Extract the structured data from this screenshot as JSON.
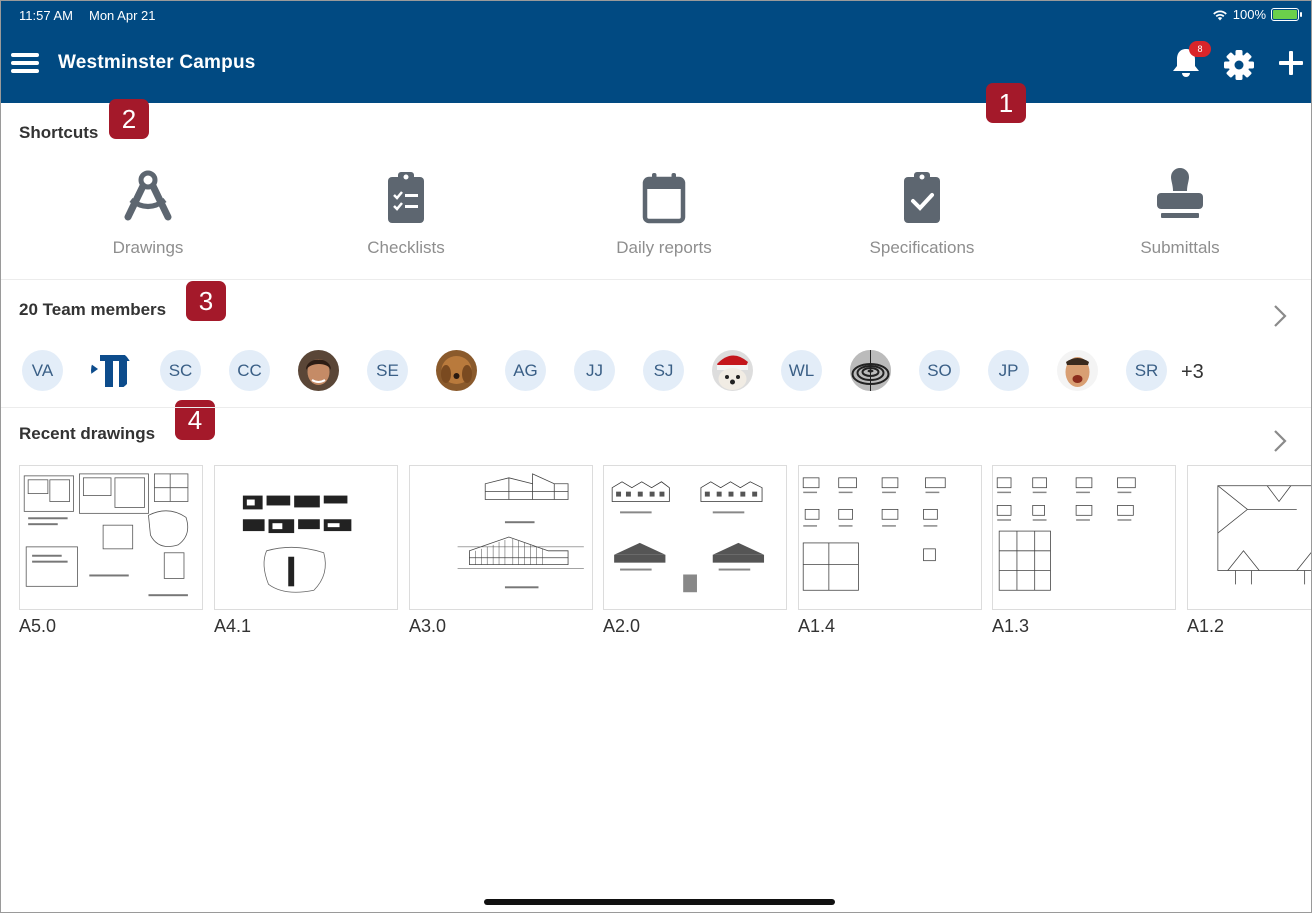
{
  "status_bar": {
    "time": "11:57 AM",
    "date": "Mon Apr 21",
    "battery": "100%"
  },
  "header": {
    "title": "Westminster Campus",
    "notification_count": "8"
  },
  "callouts": [
    "1",
    "2",
    "3",
    "4"
  ],
  "shortcuts": {
    "title": "Shortcuts",
    "items": [
      {
        "label": "Drawings",
        "icon": "drafting-compass-icon"
      },
      {
        "label": "Checklists",
        "icon": "clipboard-list-icon"
      },
      {
        "label": "Daily reports",
        "icon": "calendar-icon"
      },
      {
        "label": "Specifications",
        "icon": "clipboard-check-icon"
      },
      {
        "label": "Submittals",
        "icon": "stamp-icon"
      }
    ]
  },
  "team": {
    "title": "20 Team members",
    "members": [
      "VA",
      "",
      "SC",
      "CC",
      "",
      "SE",
      "",
      "AG",
      "JJ",
      "SJ",
      "",
      "WL",
      "",
      "SO",
      "JP",
      "",
      "SR"
    ],
    "more": "+3"
  },
  "recent_drawings": {
    "title": "Recent drawings",
    "items": [
      {
        "label": "A5.0"
      },
      {
        "label": "A4.1"
      },
      {
        "label": "A3.0"
      },
      {
        "label": "A2.0"
      },
      {
        "label": "A1.4"
      },
      {
        "label": "A1.3"
      },
      {
        "label": "A1.2"
      }
    ]
  },
  "colors": {
    "header_bg": "#014a82",
    "callout": "#a4192a",
    "badge": "#d9252a",
    "avatar_bg": "#e3edf8",
    "icon_gray": "#5d6670"
  }
}
